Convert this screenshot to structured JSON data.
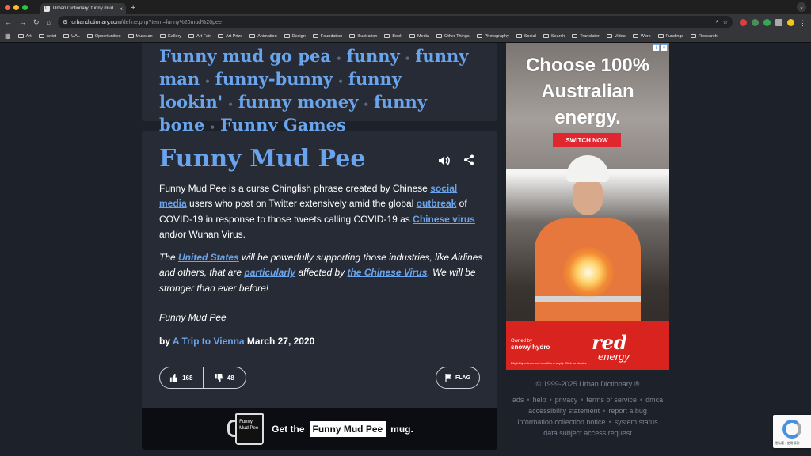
{
  "browser": {
    "tab_title": "Urban Dictionary: funny mud",
    "url_domain": "urbandictionary.com",
    "url_path": "/define.php?term=funny%20mud%20pee",
    "bookmarks": [
      "Art",
      "Artist",
      "UAL",
      "Opportunities",
      "Museum",
      "Gallery",
      "Art Fair",
      "Art Prize",
      "Animation",
      "Design",
      "Foundation",
      "Illustration",
      "Book",
      "Media",
      "Other Things",
      "Photography",
      "Social",
      "Search",
      "Translator",
      "Video",
      "Work",
      "Fundings",
      "Research"
    ]
  },
  "related": [
    "Funny mud go pea",
    "funny",
    "funny man",
    "funny-bunny",
    "funny lookin'",
    "funny money",
    "funny bone",
    "Funny Games"
  ],
  "definition": {
    "word": "Funny Mud Pee",
    "meaning": {
      "t1": "Funny Mud Pee is a curse Chinglish phrase created by Chinese ",
      "l1": "social media",
      "t2": " users who post on Twitter extensively amid the global ",
      "l2": "outbreak",
      "t3": " of COVID-19 in response to those tweets calling COVID-19 as ",
      "l3": "Chinese virus",
      "t4": " and/or Wuhan Virus."
    },
    "example": {
      "t1": "The ",
      "l1": "United States",
      "t2": " will be powerfully supporting those industries, like Airlines and others, that are ",
      "l2": "particularly",
      "t3": " affected by ",
      "l3": "the Chinese Virus",
      "t4": ". We will be stronger than ever before!"
    },
    "example2": "Funny Mud Pee",
    "by": "by ",
    "author": "A Trip to Vienna",
    "date": " March 27, 2020",
    "upvotes": "168",
    "downvotes": "48",
    "flag_label": "FLAG"
  },
  "mug": {
    "mug_text": "Funny Mud Pee",
    "prefix": "Get the",
    "name": "Funny Mud Pee",
    "suffix": "mug."
  },
  "ad": {
    "headline": "Choose 100% Australian energy.",
    "button": "SWITCH NOW",
    "owned_by": "Owned by",
    "owner": "snowy hydro",
    "brand_red": "red",
    "brand_energy": "energy",
    "fine_print": "Eligibility criteria and conditions apply. Click for details."
  },
  "footer": {
    "copyright": "© 1999-2025 Urban Dictionary ®",
    "links_row1": [
      "ads",
      "help",
      "privacy",
      "terms of service",
      "dmca"
    ],
    "links_row2": [
      "accessibility statement",
      "report a bug"
    ],
    "links_row3": [
      "information collection notice",
      "system status"
    ],
    "links_row4": [
      "data subject access request"
    ]
  },
  "recaptcha_text": "隱私權 - 使用條款",
  "colors": {
    "link": "#6aa4ec",
    "card": "#262b36",
    "page": "#1d2129"
  }
}
